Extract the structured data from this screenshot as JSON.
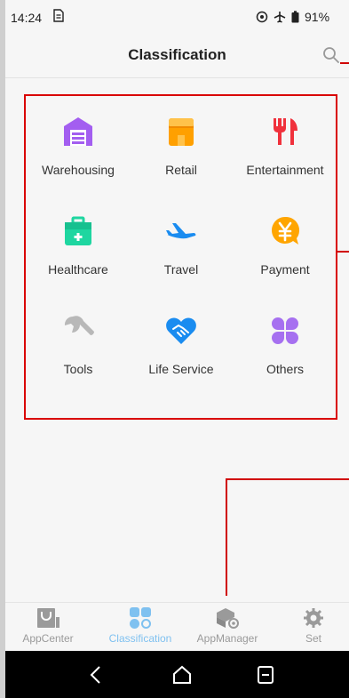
{
  "status_bar": {
    "time": "14:24",
    "sim_icon": "sim-card-icon",
    "icons": [
      "location-icon",
      "airplane-icon",
      "battery-icon"
    ],
    "battery": "91%"
  },
  "header": {
    "title": "Classification",
    "search_icon": "search-icon"
  },
  "categories": [
    {
      "label": "Warehousing",
      "icon": "warehouse-icon",
      "color": "#a35ef0"
    },
    {
      "label": "Retail",
      "icon": "store-icon",
      "color": "#ffa000"
    },
    {
      "label": "Entertainment",
      "icon": "fork-knife-icon",
      "color": "#f0313c"
    },
    {
      "label": "Healthcare",
      "icon": "first-aid-kit-icon",
      "color": "#1ed6a0"
    },
    {
      "label": "Travel",
      "icon": "airplane-icon",
      "color": "#1a8cf0"
    },
    {
      "label": "Payment",
      "icon": "yen-coin-icon",
      "color": "#ffa500"
    },
    {
      "label": "Tools",
      "icon": "wrench-icon",
      "color": "#b8b8b8"
    },
    {
      "label": "Life Service",
      "icon": "handshake-heart-icon",
      "color": "#1a8cf0"
    },
    {
      "label": "Others",
      "icon": "four-petal-icon",
      "color": "#a670f0"
    }
  ],
  "bottom_nav": {
    "active": "Classification",
    "active_color": "#7fc1f0",
    "items": [
      {
        "label": "AppCenter",
        "icon": "shopping-bag-icon"
      },
      {
        "label": "Classification",
        "icon": "grid-icon"
      },
      {
        "label": "AppManager",
        "icon": "package-gear-icon"
      },
      {
        "label": "Set",
        "icon": "gear-icon"
      }
    ]
  },
  "system_nav": [
    "back-icon",
    "home-icon",
    "recents-icon"
  ],
  "colors": {
    "annotation_red": "#d90000",
    "background": "#f6f6f6"
  }
}
